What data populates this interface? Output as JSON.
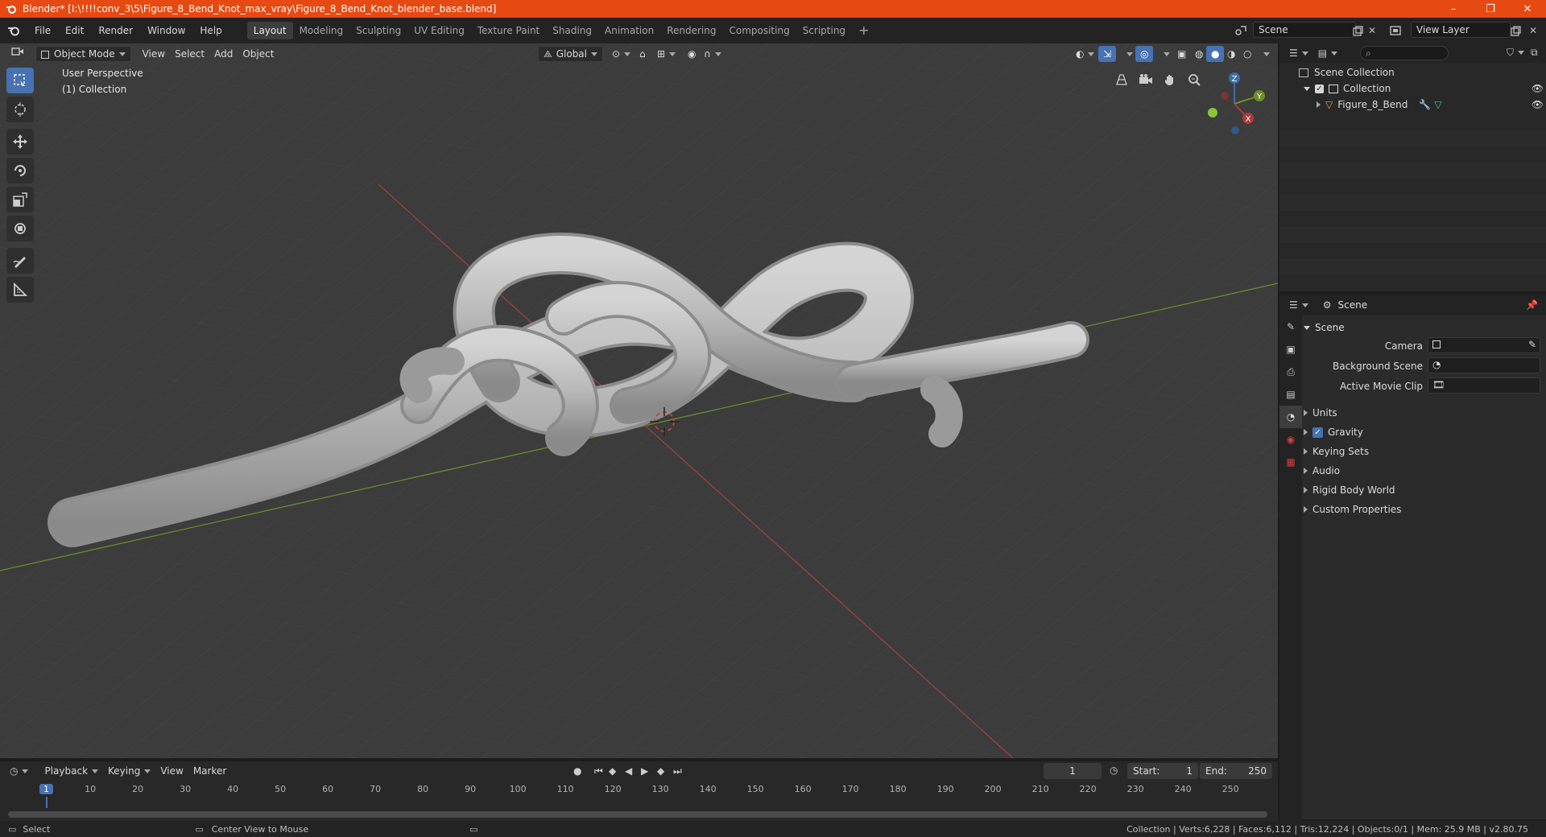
{
  "window": {
    "title": "Blender* [I:\\!!!!conv_3\\5\\Figure_8_Bend_Knot_max_vray\\Figure_8_Bend_Knot_blender_base.blend]",
    "minimize": "–",
    "maximize": "❐",
    "close": "✕"
  },
  "menu": [
    "File",
    "Edit",
    "Render",
    "Window",
    "Help"
  ],
  "workspaces": [
    "Layout",
    "Modeling",
    "Sculpting",
    "UV Editing",
    "Texture Paint",
    "Shading",
    "Animation",
    "Rendering",
    "Compositing",
    "Scripting"
  ],
  "workspace_add": "+",
  "scene_name": "Scene",
  "view_layer": "View Layer",
  "viewport": {
    "mode": "Object Mode",
    "menus": [
      "View",
      "Select",
      "Add",
      "Object"
    ],
    "orientation": "Global",
    "perspective_label": "User Perspective",
    "collection_label": "(1) Collection",
    "gizmo": {
      "z": "Z",
      "y": "Y",
      "x": "X"
    }
  },
  "outliner": {
    "scene_collection": "Scene Collection",
    "collection": "Collection",
    "object": "Figure_8_Bend"
  },
  "properties": {
    "header": "Scene",
    "panel_title": "Scene",
    "camera_label": "Camera",
    "background_scene_label": "Background Scene",
    "active_movie_clip_label": "Active Movie Clip",
    "sections": [
      "Units",
      "Gravity",
      "Keying Sets",
      "Audio",
      "Rigid Body World",
      "Custom Properties"
    ],
    "gravity_checked": true
  },
  "timeline": {
    "menus": [
      "Playback",
      "Keying",
      "View",
      "Marker"
    ],
    "current_frame": "1",
    "start_label": "Start:",
    "start_value": "1",
    "end_label": "End:",
    "end_value": "250",
    "ruler": [
      "1",
      "10",
      "20",
      "30",
      "40",
      "50",
      "60",
      "70",
      "80",
      "90",
      "100",
      "110",
      "120",
      "130",
      "140",
      "150",
      "160",
      "170",
      "180",
      "190",
      "200",
      "210",
      "220",
      "230",
      "240",
      "250"
    ]
  },
  "status": {
    "select": "Select",
    "center_view": "Center View to Mouse",
    "stats": "Collection | Verts:6,228 | Faces:6,112 | Tris:12,224 | Objects:0/1 | Mem: 25.9 MB | v2.80.75"
  },
  "colors": {
    "title_bar": "#e64a12",
    "accent": "#4772b3",
    "viewport_bg": "#3c3c3c",
    "axis_x": "#b54d4d",
    "axis_y": "#7b9a3a",
    "knot": "#b9b9b9"
  }
}
